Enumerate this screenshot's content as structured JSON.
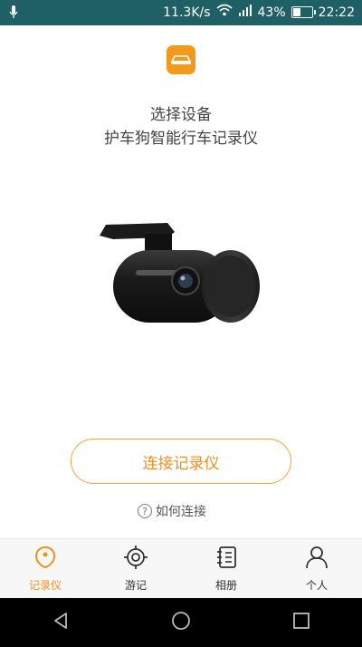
{
  "status_bar": {
    "speed": "11.3K/s",
    "battery_percent": "43%",
    "battery_level": 0.43,
    "time": "22:22"
  },
  "header": {
    "title": "选择设备",
    "subtitle": "护车狗智能行车记录仪"
  },
  "actions": {
    "connect_label": "连接记录仪",
    "how_to_connect": "如何连接",
    "help_symbol": "?"
  },
  "tabs": [
    {
      "label": "记录仪",
      "icon": "recorder-icon",
      "active": true
    },
    {
      "label": "游记",
      "icon": "target-icon",
      "active": false
    },
    {
      "label": "相册",
      "icon": "album-icon",
      "active": false
    },
    {
      "label": "个人",
      "icon": "person-icon",
      "active": false
    }
  ],
  "colors": {
    "accent": "#f08f1a",
    "status_bar": "#1f5f66",
    "nav_bar": "#000000"
  }
}
